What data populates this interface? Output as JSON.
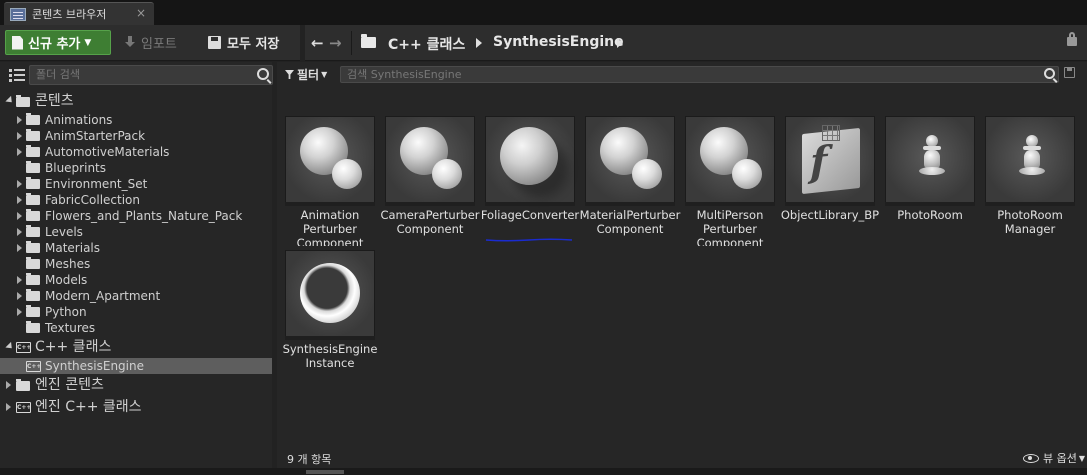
{
  "tab": {
    "title": "콘텐츠 브라우저",
    "close": "×"
  },
  "toolbar": {
    "add_new": "신규 추가",
    "import": "임포트",
    "save_all": "모두 저장"
  },
  "path": {
    "back": "←",
    "forward": "→",
    "crumbs": [
      "C++ 클래스",
      "SynthesisEngine"
    ]
  },
  "sources": {
    "search_placeholder": "폴더 검색",
    "tree": [
      {
        "label": "콘텐츠",
        "kind": "root-open"
      },
      {
        "label": "Animations",
        "kind": "child-exp"
      },
      {
        "label": "AnimStarterPack",
        "kind": "child-exp"
      },
      {
        "label": "AutomotiveMaterials",
        "kind": "child-exp"
      },
      {
        "label": "Blueprints",
        "kind": "child"
      },
      {
        "label": "Environment_Set",
        "kind": "child-exp"
      },
      {
        "label": "FabricCollection",
        "kind": "child-exp"
      },
      {
        "label": "Flowers_and_Plants_Nature_Pack",
        "kind": "child-exp"
      },
      {
        "label": "Levels",
        "kind": "child-exp"
      },
      {
        "label": "Materials",
        "kind": "child-exp"
      },
      {
        "label": "Meshes",
        "kind": "child"
      },
      {
        "label": "Models",
        "kind": "child-exp"
      },
      {
        "label": "Modern_Apartment",
        "kind": "child-exp"
      },
      {
        "label": "Python",
        "kind": "child-exp"
      },
      {
        "label": "Textures",
        "kind": "child"
      },
      {
        "label": "C++ 클래스",
        "kind": "cpp-root-open"
      },
      {
        "label": "SynthesisEngine",
        "kind": "cpp-child-selected"
      },
      {
        "label": "엔진 콘텐츠",
        "kind": "root-closed"
      },
      {
        "label": "엔진 C++ 클래스",
        "kind": "cpp-root-closed"
      }
    ]
  },
  "assets": {
    "filter_label": "필터",
    "search_placeholder": "검색 SynthesisEngine",
    "items": [
      {
        "label": "Animation Perturber Component",
        "thumb": "two-spheres-icon"
      },
      {
        "label": "CameraPerturber Component",
        "thumb": "two-spheres-icon"
      },
      {
        "label": "FoliageConverter",
        "thumb": "sphere-icon"
      },
      {
        "label": "MaterialPerturber Component",
        "thumb": "two-spheres-icon"
      },
      {
        "label": "MultiPerson Perturber Component",
        "thumb": "two-spheres-icon"
      },
      {
        "label": "ObjectLibrary_BP",
        "thumb": "function-library-icon"
      },
      {
        "label": "PhotoRoom",
        "thumb": "pawn-icon"
      },
      {
        "label": "PhotoRoom Manager",
        "thumb": "pawn-icon"
      },
      {
        "label": "SynthesisEngine Instance",
        "thumb": "torus-icon"
      }
    ],
    "count_text": "9 개 항목",
    "view_options": "뷰 옵션"
  },
  "colors": {
    "add_button": "#3e7e33",
    "underline": "#1a2bd0",
    "selection": "#5e5e5e"
  }
}
